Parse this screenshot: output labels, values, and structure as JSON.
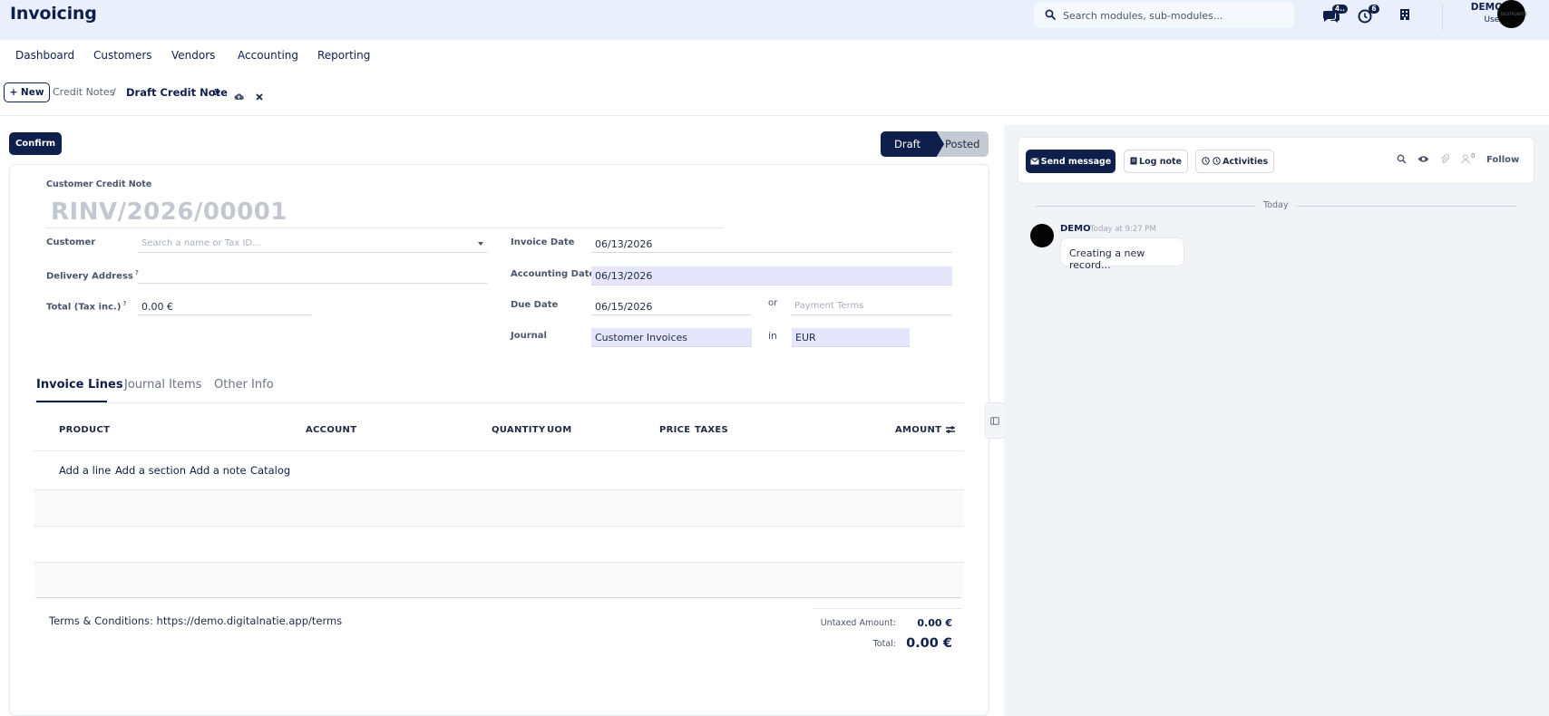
{
  "header": {
    "app_title": "Invoicing",
    "search_placeholder": "Search modules, sub-modules...",
    "messages_badge": "4..",
    "activities_badge": "6",
    "user_name": "DEMO",
    "user_role": "User",
    "avatar_text": "DIGITALNATIE"
  },
  "menu": {
    "dashboard": "Dashboard",
    "customers": "Customers",
    "vendors": "Vendors",
    "accounting": "Accounting",
    "reporting": "Reporting"
  },
  "breadcrumb": {
    "new_label": "+ New",
    "parent": "Credit Notes",
    "separator": "/",
    "current": "Draft Credit Note"
  },
  "form": {
    "confirm_label": "Confirm",
    "status_draft": "Draft",
    "status_posted": "Posted",
    "doc_type": "Customer Credit Note",
    "doc_name": "RINV/2026/00001",
    "customer_label": "Customer",
    "customer_placeholder": "Search a name or Tax ID...",
    "delivery_label": "Delivery Address",
    "total_label": "Total (Tax inc.)",
    "total_value": "0.00 €",
    "help_mark": "?",
    "invoice_date_label": "Invoice Date",
    "invoice_date": "06/13/2026",
    "accounting_date_label": "Accounting Date",
    "accounting_date": "06/13/2026",
    "due_date_label": "Due Date",
    "due_date": "06/15/2026",
    "or_label": "or",
    "payment_terms_placeholder": "Payment Terms",
    "journal_label": "Journal",
    "journal_value": "Customer Invoices",
    "in_label": "in",
    "currency_value": "EUR"
  },
  "tabs": {
    "invoice_lines": "Invoice Lines",
    "journal_items": "Journal Items",
    "other_info": "Other Info"
  },
  "table": {
    "columns": {
      "product": "PRODUCT",
      "account": "ACCOUNT",
      "quantity": "QUANTITY",
      "uom": "UOM",
      "price": "PRICE",
      "taxes": "TAXES",
      "amount": "AMOUNT"
    },
    "add_line": "Add a line",
    "add_section": "Add a section",
    "add_note": "Add a note",
    "catalog": "Catalog"
  },
  "footer": {
    "terms": "Terms & Conditions: https://demo.digitalnatie.app/terms",
    "untaxed_label": "Untaxed Amount:",
    "untaxed_value": "0.00 €",
    "total_label": "Total:",
    "total_value": "0.00 €"
  },
  "chatter": {
    "send_message": "Send message",
    "log_note": "Log note",
    "activities": "Activities",
    "followers_count": "0",
    "follow": "Follow",
    "today": "Today",
    "author": "DEMO",
    "time": "Today at 9:27 PM",
    "message": "Creating a new record..."
  },
  "colors": {
    "primary": "#0f1f4b",
    "topbar": "#e9f0fb",
    "filled_field": "#e5e5fb",
    "chatter_bg": "#f2f3f6"
  }
}
